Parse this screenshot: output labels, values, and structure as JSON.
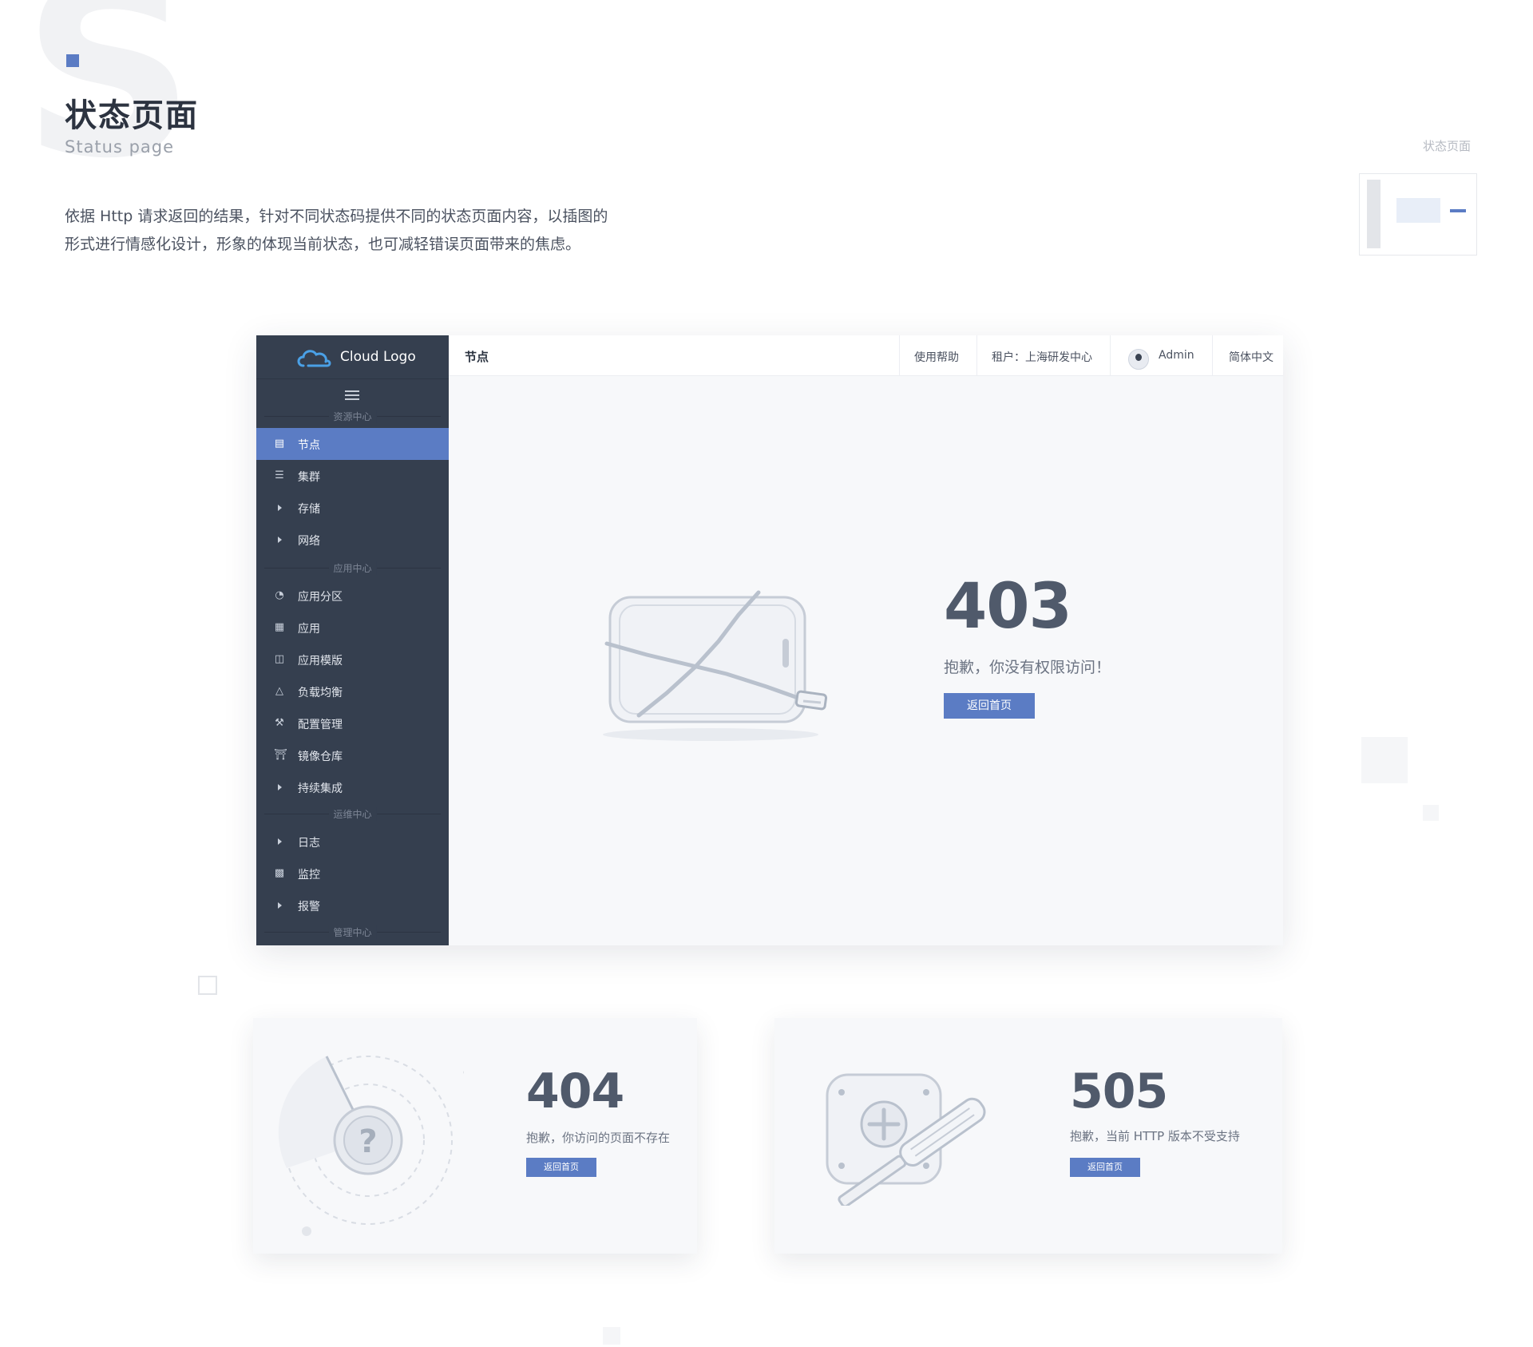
{
  "colors": {
    "accent": "#5b7cc4",
    "sidebar": "#353f4f",
    "text_dark": "#2c3340"
  },
  "header": {
    "bg_letter": "S",
    "title": "状态页面",
    "subtitle": "Status page",
    "description_line1": "依据 Http 请求返回的结果，针对不同状态码提供不同的状态页面内容，以插图的",
    "description_line2": "形式进行情感化设计，形象的体现当前状态，也可减轻错误页面带来的焦虑。",
    "corner_label": "状态页面"
  },
  "app": {
    "brand": "Cloud Logo",
    "sections": {
      "resource": "资源中心",
      "application": "应用中心",
      "ops": "运维中心",
      "admin": "管理中心"
    },
    "nav": [
      {
        "label": "节点",
        "icon": "server-icon",
        "active": true
      },
      {
        "label": "集群",
        "icon": "list-icon"
      },
      {
        "label": "存储",
        "icon": "caret-right-icon"
      },
      {
        "label": "网络",
        "icon": "caret-right-icon"
      },
      {
        "label": "应用分区",
        "icon": "pie-icon"
      },
      {
        "label": "应用",
        "icon": "grid-icon"
      },
      {
        "label": "应用模版",
        "icon": "template-icon"
      },
      {
        "label": "负载均衡",
        "icon": "nodes-icon"
      },
      {
        "label": "配置管理",
        "icon": "wrench-icon"
      },
      {
        "label": "镜像仓库",
        "icon": "warehouse-icon"
      },
      {
        "label": "持续集成",
        "icon": "caret-right-icon"
      },
      {
        "label": "日志",
        "icon": "caret-right-icon"
      },
      {
        "label": "监控",
        "icon": "monitor-icon"
      },
      {
        "label": "报警",
        "icon": "caret-right-icon"
      }
    ],
    "topbar": {
      "breadcrumb": "节点",
      "help": "使用帮助",
      "tenant": "租户：上海研发中心",
      "user": "Admin",
      "language": "简体中文"
    },
    "error_403": {
      "code": "403",
      "message": "抱歉，你没有权限访问！",
      "button": "返回首页"
    }
  },
  "cards": {
    "error_404": {
      "code": "404",
      "message": "抱歉，你访问的页面不存在",
      "button": "返回首页"
    },
    "error_505": {
      "code": "505",
      "message": "抱歉，当前 HTTP 版本不受支持",
      "button": "返回首页"
    }
  }
}
